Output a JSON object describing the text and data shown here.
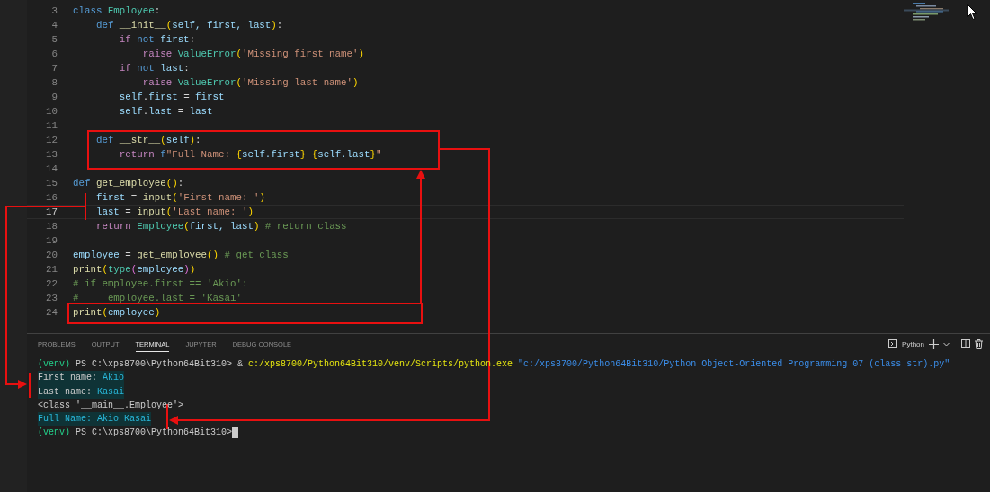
{
  "editor": {
    "lines": [
      {
        "number": "3",
        "current": false,
        "tokens": [
          {
            "text": "class",
            "kind": "keyword"
          },
          {
            "text": " Employee",
            "kind": "class"
          },
          {
            "text": ":",
            "kind": "plain"
          }
        ]
      },
      {
        "number": "4",
        "current": false,
        "tokens": [
          {
            "text": "    def",
            "kind": "keyword"
          },
          {
            "text": " __init__",
            "kind": "function"
          },
          {
            "text": "(",
            "kind": "bracket"
          },
          {
            "text": "self",
            "kind": "variable"
          },
          {
            "text": ", first",
            "kind": "variable"
          },
          {
            "text": ", last",
            "kind": "variable"
          },
          {
            "text": ")",
            "kind": "bracket"
          },
          {
            "text": ":",
            "kind": "plain"
          }
        ]
      },
      {
        "number": "5",
        "current": false,
        "tokens": [
          {
            "text": "        if",
            "kind": "control"
          },
          {
            "text": " not",
            "kind": "keyword"
          },
          {
            "text": " first",
            "kind": "variable"
          },
          {
            "text": ":",
            "kind": "plain"
          }
        ]
      },
      {
        "number": "6",
        "current": false,
        "tokens": [
          {
            "text": "            raise",
            "kind": "control"
          },
          {
            "text": " ValueError",
            "kind": "class"
          },
          {
            "text": "(",
            "kind": "bracket"
          },
          {
            "text": "'Missing first name'",
            "kind": "string"
          },
          {
            "text": ")",
            "kind": "bracket"
          }
        ]
      },
      {
        "number": "7",
        "current": false,
        "tokens": [
          {
            "text": "        if",
            "kind": "control"
          },
          {
            "text": " not",
            "kind": "keyword"
          },
          {
            "text": " last",
            "kind": "variable"
          },
          {
            "text": ":",
            "kind": "plain"
          }
        ]
      },
      {
        "number": "8",
        "current": false,
        "tokens": [
          {
            "text": "            raise",
            "kind": "control"
          },
          {
            "text": " ValueError",
            "kind": "class"
          },
          {
            "text": "(",
            "kind": "bracket"
          },
          {
            "text": "'Missing last name'",
            "kind": "string"
          },
          {
            "text": ")",
            "kind": "bracket"
          }
        ]
      },
      {
        "number": "9",
        "current": false,
        "tokens": [
          {
            "text": "        self",
            "kind": "variable"
          },
          {
            "text": ".",
            "kind": "plain"
          },
          {
            "text": "first",
            "kind": "variable"
          },
          {
            "text": " =",
            "kind": "plain"
          },
          {
            "text": " first",
            "kind": "variable"
          }
        ]
      },
      {
        "number": "10",
        "current": false,
        "tokens": [
          {
            "text": "        self",
            "kind": "variable"
          },
          {
            "text": ".",
            "kind": "plain"
          },
          {
            "text": "last",
            "kind": "variable"
          },
          {
            "text": " =",
            "kind": "plain"
          },
          {
            "text": " last",
            "kind": "variable"
          }
        ]
      },
      {
        "number": "11",
        "current": false
      },
      {
        "number": "12",
        "current": false,
        "tokens": [
          {
            "text": "    def",
            "kind": "keyword"
          },
          {
            "text": " __str__",
            "kind": "function"
          },
          {
            "text": "(",
            "kind": "bracket"
          },
          {
            "text": "self",
            "kind": "variable"
          },
          {
            "text": ")",
            "kind": "bracket"
          },
          {
            "text": ":",
            "kind": "plain"
          }
        ]
      },
      {
        "number": "13",
        "current": false,
        "tokens": [
          {
            "text": "        return",
            "kind": "control"
          },
          {
            "text": " f",
            "kind": "keyword"
          },
          {
            "text": "\"Full Name: ",
            "kind": "string"
          },
          {
            "text": "{",
            "kind": "bracket"
          },
          {
            "text": "self.first",
            "kind": "variable"
          },
          {
            "text": "}",
            "kind": "bracket"
          },
          {
            "text": " {",
            "kind": "bracket"
          },
          {
            "text": "self.last",
            "kind": "variable"
          },
          {
            "text": "}",
            "kind": "bracket"
          },
          {
            "text": "\"",
            "kind": "string"
          }
        ]
      },
      {
        "number": "14",
        "current": false
      },
      {
        "number": "15",
        "current": false,
        "tokens": [
          {
            "text": "def",
            "kind": "keyword"
          },
          {
            "text": " get_employee",
            "kind": "function"
          },
          {
            "text": "()",
            "kind": "bracket"
          },
          {
            "text": ":",
            "kind": "plain"
          }
        ]
      },
      {
        "number": "16",
        "current": false,
        "tokens": [
          {
            "text": "    first",
            "kind": "variable"
          },
          {
            "text": " =",
            "kind": "plain"
          },
          {
            "text": " input",
            "kind": "function"
          },
          {
            "text": "(",
            "kind": "bracket"
          },
          {
            "text": "'First name: '",
            "kind": "string"
          },
          {
            "text": ")",
            "kind": "bracket"
          }
        ]
      },
      {
        "number": "17",
        "current": true,
        "tokens": [
          {
            "text": "    last",
            "kind": "variable"
          },
          {
            "text": " =",
            "kind": "plain"
          },
          {
            "text": " input",
            "kind": "function"
          },
          {
            "text": "(",
            "kind": "bracket"
          },
          {
            "text": "'Last name: '",
            "kind": "string"
          },
          {
            "text": ")",
            "kind": "bracket"
          }
        ]
      },
      {
        "number": "18",
        "current": false,
        "tokens": [
          {
            "text": "    return",
            "kind": "control"
          },
          {
            "text": " Employee",
            "kind": "class"
          },
          {
            "text": "(",
            "kind": "bracket"
          },
          {
            "text": "first",
            "kind": "variable"
          },
          {
            "text": ", last",
            "kind": "variable"
          },
          {
            "text": ")",
            "kind": "bracket"
          },
          {
            "text": " # return class",
            "kind": "comment"
          }
        ]
      },
      {
        "number": "19",
        "current": false
      },
      {
        "number": "20",
        "current": false,
        "tokens": [
          {
            "text": "employee",
            "kind": "variable"
          },
          {
            "text": " =",
            "kind": "plain"
          },
          {
            "text": " get_employee",
            "kind": "function"
          },
          {
            "text": "()",
            "kind": "bracket"
          },
          {
            "text": " # get class",
            "kind": "comment"
          }
        ]
      },
      {
        "number": "21",
        "current": false,
        "tokens": [
          {
            "text": "print",
            "kind": "function"
          },
          {
            "text": "(",
            "kind": "bracket"
          },
          {
            "text": "type",
            "kind": "class"
          },
          {
            "text": "(",
            "kind": "bracket2"
          },
          {
            "text": "employee",
            "kind": "variable"
          },
          {
            "text": ")",
            "kind": "bracket2"
          },
          {
            "text": ")",
            "kind": "bracket"
          }
        ]
      },
      {
        "number": "22",
        "current": false,
        "tokens": [
          {
            "text": "# if employee.first == 'Akio':",
            "kind": "comment"
          }
        ]
      },
      {
        "number": "23",
        "current": false,
        "tokens": [
          {
            "text": "#     employee.last = 'Kasai'",
            "kind": "comment"
          }
        ]
      },
      {
        "number": "24",
        "current": false,
        "tokens": [
          {
            "text": "print",
            "kind": "function"
          },
          {
            "text": "(",
            "kind": "bracket"
          },
          {
            "text": "employee",
            "kind": "variable"
          },
          {
            "text": ")",
            "kind": "bracket"
          }
        ]
      }
    ]
  },
  "panel": {
    "tabs": [
      {
        "label": "PROBLEMS",
        "selected": false
      },
      {
        "label": "OUTPUT",
        "selected": false
      },
      {
        "label": "TERMINAL",
        "selected": true
      },
      {
        "label": "JUPYTER",
        "selected": false
      },
      {
        "label": "DEBUG CONSOLE",
        "selected": false
      }
    ],
    "shell": "Python"
  },
  "terminal": {
    "lines": [
      {
        "highlighted": false,
        "cursor": false,
        "tokens": [
          {
            "text": "(venv)",
            "kind": "venv"
          },
          {
            "text": " PS C:\\xps8700\\Python64Bit310> &",
            "kind": "plain"
          },
          {
            "text": " c:/xps8700/Python64Bit310/venv/Scripts/python.exe",
            "kind": "path"
          },
          {
            "text": " \"c:/xps8700/Python64Bit310/Python Object-Oriented Programming 07 (class str).py\"",
            "kind": "quoted"
          }
        ]
      },
      {
        "highlighted": true,
        "cursor": false,
        "tokens": [
          {
            "text": "First name: ",
            "kind": "plain"
          },
          {
            "text": "Akio",
            "kind": "input"
          }
        ]
      },
      {
        "highlighted": true,
        "cursor": false,
        "tokens": [
          {
            "text": "Last name: ",
            "kind": "plain"
          },
          {
            "text": "Kasai",
            "kind": "input"
          }
        ]
      },
      {
        "highlighted": false,
        "cursor": false,
        "tokens": [
          {
            "text": "<class '__main__.Employee'>",
            "kind": "plain"
          }
        ]
      },
      {
        "highlighted": true,
        "cursor": false,
        "tokens": [
          {
            "text": "Full Name: Akio Kasai",
            "kind": "input"
          }
        ]
      },
      {
        "highlighted": false,
        "cursor": true,
        "tokens": [
          {
            "text": "(venv)",
            "kind": "venv"
          },
          {
            "text": " PS C:\\xps8700\\Python64Bit310>",
            "kind": "plain"
          }
        ]
      }
    ]
  }
}
